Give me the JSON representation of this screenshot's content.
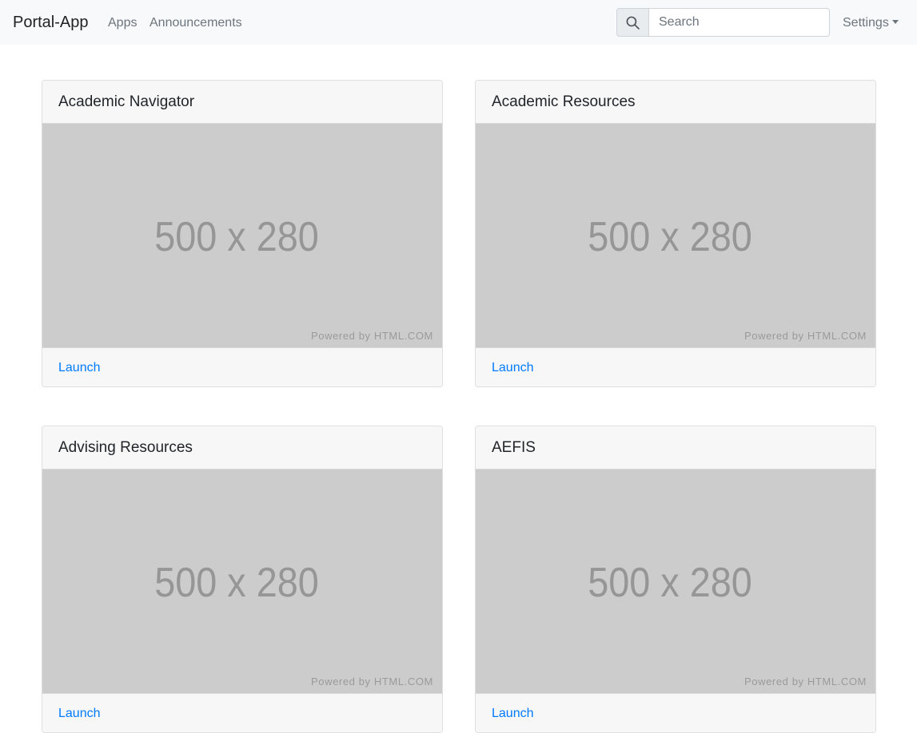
{
  "navbar": {
    "brand": "Portal-App",
    "links": [
      "Apps",
      "Announcements"
    ],
    "search": {
      "placeholder": "Search",
      "value": ""
    },
    "settings_label": "Settings"
  },
  "icons": {
    "search": "search-icon",
    "caret": "caret-down-icon"
  },
  "colors": {
    "link": "#007bff",
    "placeholder_bg": "#cccccc",
    "navbar_bg": "#f8f9fa"
  },
  "cards": [
    {
      "title": "Academic Navigator",
      "image_text": "500 x 280",
      "image_credit": "Powered by HTML.COM",
      "action": "Launch"
    },
    {
      "title": "Academic Resources",
      "image_text": "500 x 280",
      "image_credit": "Powered by HTML.COM",
      "action": "Launch"
    },
    {
      "title": "Advising Resources",
      "image_text": "500 x 280",
      "image_credit": "Powered by HTML.COM",
      "action": "Launch"
    },
    {
      "title": "AEFIS",
      "image_text": "500 x 280",
      "image_credit": "Powered by HTML.COM",
      "action": "Launch"
    }
  ]
}
